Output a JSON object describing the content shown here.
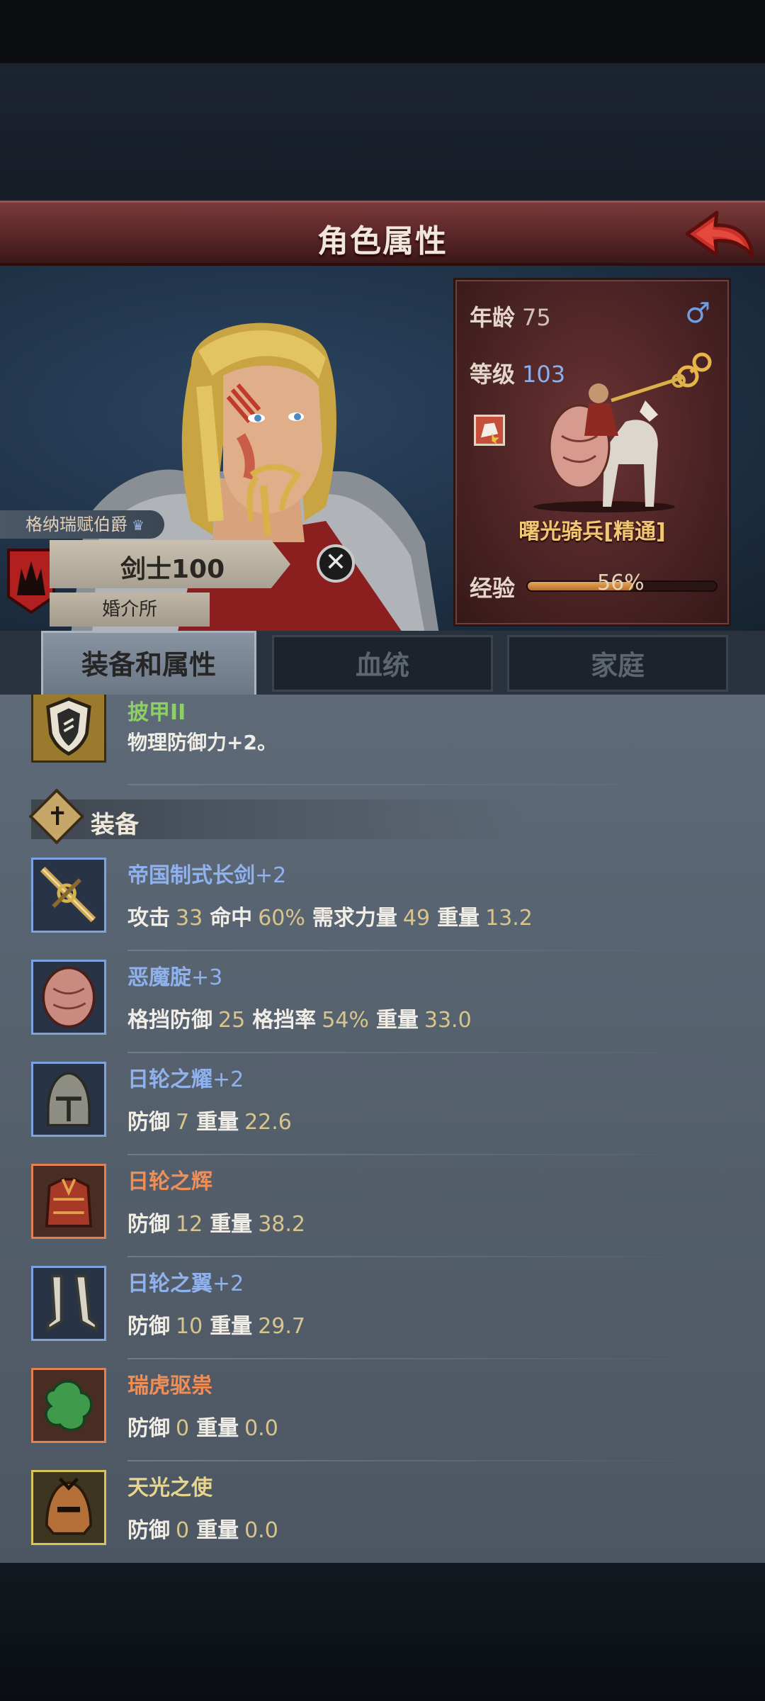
{
  "header": {
    "title": "角色属性"
  },
  "hero": {
    "title_tag": "格纳瑞赋伯爵",
    "class_label": "剑士100",
    "house_label": "婚介所"
  },
  "info": {
    "age_label": "年龄",
    "age_value": "75",
    "gender_symbol": "♂",
    "level_label": "等级",
    "level_value": "103",
    "unit_name": "曙光骑兵[精通]",
    "exp_label": "经验",
    "exp_value": "56%",
    "exp_progress": 0.56
  },
  "tabs": [
    {
      "label": "装备和属性",
      "active": true
    },
    {
      "label": "血统",
      "active": false
    },
    {
      "label": "家庭",
      "active": false
    }
  ],
  "armor_trait": {
    "name": "披甲II",
    "desc": "物理防御力+2。"
  },
  "equipment_section": {
    "label": "装备"
  },
  "equipment": [
    {
      "name_main": "帝国制式长剑",
      "name_suffix": "+2",
      "stats": [
        {
          "k": "攻击",
          "v": "33"
        },
        {
          "k": "命中",
          "v": "60%"
        },
        {
          "k": "需求力量",
          "v": "49"
        },
        {
          "k": "重量",
          "v": "13.2"
        }
      ]
    },
    {
      "name_main": "恶魔腚",
      "name_suffix": "+3",
      "stats": [
        {
          "k": "格挡防御",
          "v": "25"
        },
        {
          "k": "格挡率",
          "v": "54%"
        },
        {
          "k": "重量",
          "v": "33.0"
        }
      ]
    },
    {
      "name_main": "日轮之耀",
      "name_suffix": "+2",
      "stats": [
        {
          "k": "防御",
          "v": "7"
        },
        {
          "k": "重量",
          "v": "22.6"
        }
      ]
    },
    {
      "name_main": "日轮之辉",
      "name_suffix": "",
      "stats": [
        {
          "k": "防御",
          "v": "12"
        },
        {
          "k": "重量",
          "v": "38.2"
        }
      ]
    },
    {
      "name_main": "日轮之翼",
      "name_suffix": "+2",
      "stats": [
        {
          "k": "防御",
          "v": "10"
        },
        {
          "k": "重量",
          "v": "29.7"
        }
      ]
    },
    {
      "name_main": "瑞虎驱祟",
      "name_suffix": "",
      "stats": [
        {
          "k": "防御",
          "v": "0"
        },
        {
          "k": "重量",
          "v": "0.0"
        }
      ]
    },
    {
      "name_main": "天光之使",
      "name_suffix": "",
      "stats": [
        {
          "k": "防御",
          "v": "0"
        },
        {
          "k": "重量",
          "v": "0.0"
        }
      ]
    }
  ]
}
